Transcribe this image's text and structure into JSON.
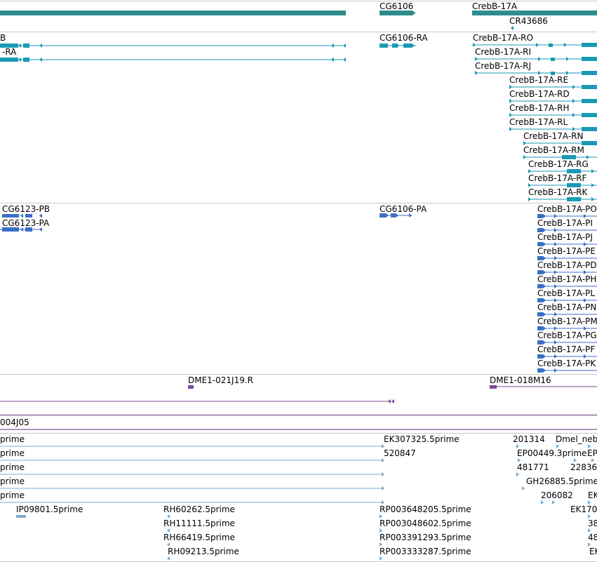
{
  "track_colors": {
    "gene": "#2e8c8c",
    "mrna": "#1a9ab3",
    "protein": "#3a6fc8",
    "clone": "#7a4a9a",
    "est": "#7aaed6",
    "line": "#c8c8c8"
  },
  "genes": [
    "CG6106",
    "CrebB-17A",
    "CR43686"
  ],
  "transcripts_left": [
    "B",
    "-RA"
  ],
  "transcripts_mid": [
    "CG6106-RA"
  ],
  "transcripts_right": [
    "CrebB-17A-RO",
    "CrebB-17A-RI",
    "CrebB-17A-RJ",
    "CrebB-17A-RE",
    "CrebB-17A-RD",
    "CrebB-17A-RH",
    "CrebB-17A-RL",
    "CrebB-17A-RN",
    "CrebB-17A-RM",
    "CrebB-17A-RG",
    "CrebB-17A-RF",
    "CrebB-17A-RK"
  ],
  "proteins_left": [
    "CG6123-PB",
    "CG6123-PA"
  ],
  "proteins_mid": [
    "CG6106-PA"
  ],
  "proteins_right": [
    "CrebB-17A-PO",
    "CrebB-17A-PI",
    "CrebB-17A-PJ",
    "CrebB-17A-PE",
    "CrebB-17A-PD",
    "CrebB-17A-PH",
    "CrebB-17A-PL",
    "CrebB-17A-PN",
    "CrebB-17A-PM",
    "CrebB-17A-PG",
    "CrebB-17A-PF",
    "CrebB-17A-PK"
  ],
  "clones": [
    "DME1-021J19.R",
    "DME1-018M16",
    "004J05"
  ],
  "ests_left": [
    "prime",
    "prime",
    "prime",
    "prime",
    "prime"
  ],
  "ests_mid": [
    "EK307325.5prime",
    "520847"
  ],
  "ests_right": [
    "201314",
    "Dmel_neb",
    "EP00449.3prime",
    "EP",
    "481771",
    "22836",
    "GH26885.5prime",
    "206082",
    "EK",
    "EK170",
    "38",
    "48",
    "EK"
  ],
  "ests_bottom": [
    "IP09801.5prime",
    "RH60262.5prime",
    "RH11111.5prime",
    "RH66419.5prime",
    "RH09213.5prime",
    "RP003648205.5prime",
    "RP003048602.5prime",
    "RP003391293.5prime",
    "RP003333287.5prime"
  ]
}
